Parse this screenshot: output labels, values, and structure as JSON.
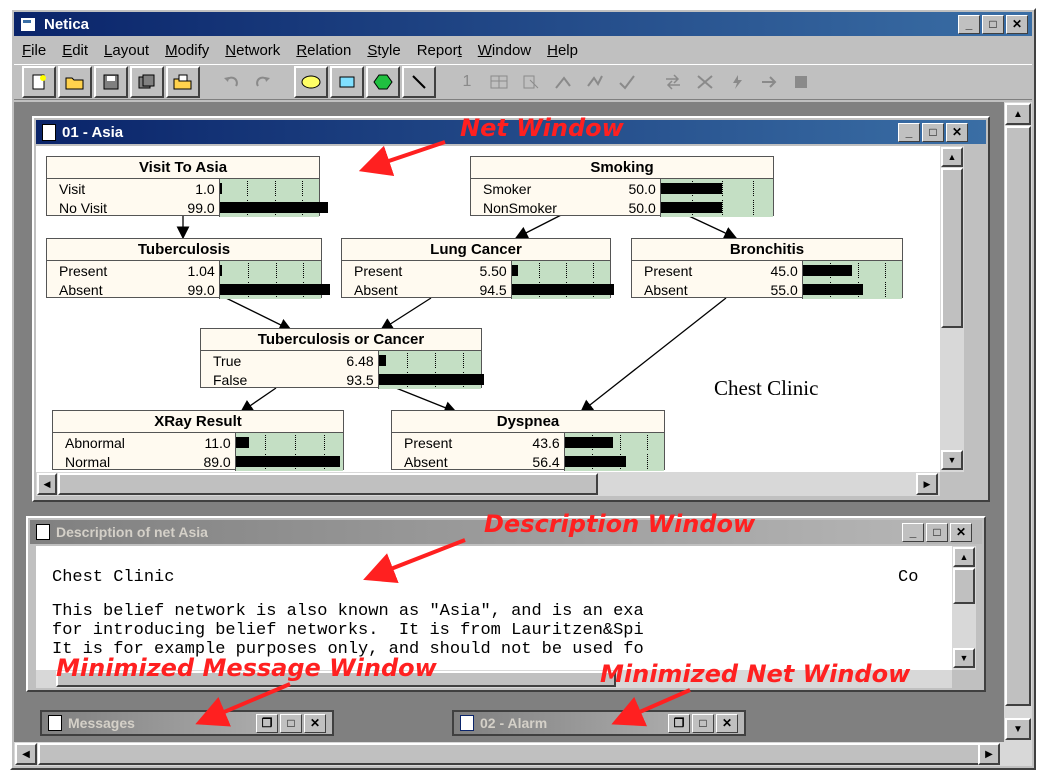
{
  "app": {
    "title": "Netica",
    "menu": [
      "File",
      "Edit",
      "Layout",
      "Modify",
      "Network",
      "Relation",
      "Style",
      "Report",
      "Window",
      "Help"
    ],
    "menu_underline": [
      "F",
      "E",
      "L",
      "M",
      "N",
      "R",
      "S",
      "t",
      "W",
      "H"
    ]
  },
  "net_window": {
    "title": "01 - Asia",
    "label": "Chest Clinic",
    "nodes": {
      "visit": {
        "title": "Visit To Asia",
        "states": [
          {
            "name": "Visit",
            "value": "1.0",
            "frac": 0.01
          },
          {
            "name": "No Visit",
            "value": "99.0",
            "frac": 0.99
          }
        ]
      },
      "smoking": {
        "title": "Smoking",
        "states": [
          {
            "name": "Smoker",
            "value": "50.0",
            "frac": 0.5
          },
          {
            "name": "NonSmoker",
            "value": "50.0",
            "frac": 0.5
          }
        ]
      },
      "tuberculosis": {
        "title": "Tuberculosis",
        "states": [
          {
            "name": "Present",
            "value": "1.04",
            "frac": 0.0104
          },
          {
            "name": "Absent",
            "value": "99.0",
            "frac": 0.99
          }
        ]
      },
      "lungcancer": {
        "title": "Lung Cancer",
        "states": [
          {
            "name": "Present",
            "value": "5.50",
            "frac": 0.055
          },
          {
            "name": "Absent",
            "value": "94.5",
            "frac": 0.945
          }
        ]
      },
      "bronchitis": {
        "title": "Bronchitis",
        "states": [
          {
            "name": "Present",
            "value": "45.0",
            "frac": 0.45
          },
          {
            "name": "Absent",
            "value": "55.0",
            "frac": 0.55
          }
        ]
      },
      "tborca": {
        "title": "Tuberculosis or Cancer",
        "states": [
          {
            "name": "True",
            "value": "6.48",
            "frac": 0.0648
          },
          {
            "name": "False",
            "value": "93.5",
            "frac": 0.935
          }
        ]
      },
      "xray": {
        "title": "XRay Result",
        "states": [
          {
            "name": "Abnormal",
            "value": "11.0",
            "frac": 0.11
          },
          {
            "name": "Normal",
            "value": "89.0",
            "frac": 0.89
          }
        ]
      },
      "dyspnea": {
        "title": "Dyspnea",
        "states": [
          {
            "name": "Present",
            "value": "43.6",
            "frac": 0.436
          },
          {
            "name": "Absent",
            "value": "56.4",
            "frac": 0.564
          }
        ]
      }
    }
  },
  "desc_window": {
    "title": "Description of net Asia",
    "line1": "Chest Clinic",
    "line1_right": "Co",
    "line2": "This belief network is also known as \"Asia\", and is an exa",
    "line3": "for introducing belief networks.  It is from Lauritzen&Spi",
    "line4": "It is for example purposes only, and should not be used fo"
  },
  "minimized": {
    "messages": "Messages",
    "alarm": "02 - Alarm"
  },
  "annotations": {
    "net": "Net Window",
    "desc": "Description Window",
    "msg": "Minimized Message Window",
    "minnet": "Minimized Net Window"
  },
  "colors": {
    "annotation": "#ff2020",
    "titlebar": "#0a246a",
    "bar_bg": "#c4dfc4",
    "desktop": "#808080"
  }
}
